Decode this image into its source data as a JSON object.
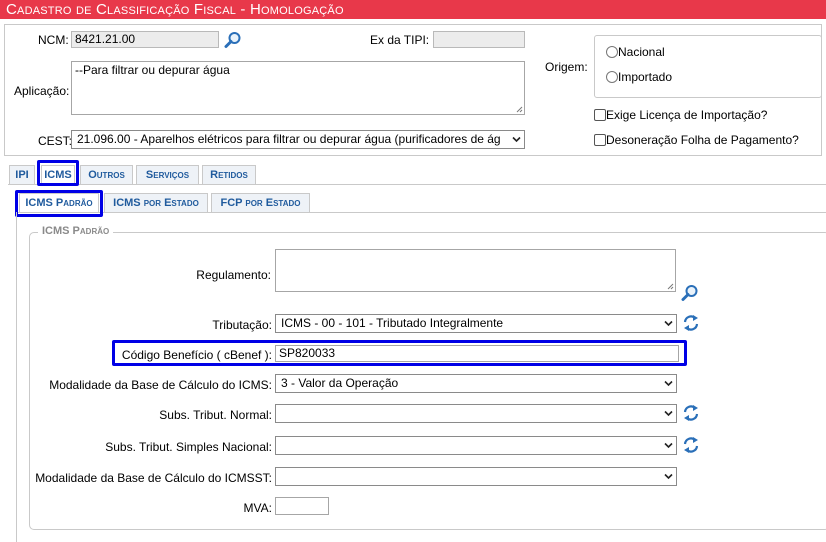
{
  "window": {
    "title": "Cadastro de Classificação Fiscal - Homologação"
  },
  "header": {
    "ncm": {
      "label": "NCM:",
      "value": "8421.21.00"
    },
    "ex_tipi": {
      "label": "Ex da TIPI:",
      "value": ""
    },
    "aplicacao": {
      "label": "Aplicação:",
      "value": "--Para filtrar ou depurar água"
    },
    "cest": {
      "label": "CEST:",
      "value": "21.096.00 - Aparelhos elétricos para filtrar ou depurar água (purificadores de ág"
    },
    "origem": {
      "label": "Origem:",
      "options": [
        "Nacional",
        "Importado"
      ]
    },
    "checks": {
      "licenca": "Exige Licença de Importação?",
      "desoneracao": "Desoneração Folha de Pagamento?"
    }
  },
  "tabs": [
    "IPI",
    "ICMS",
    "Outros",
    "Serviços",
    "Retidos"
  ],
  "subtabs": [
    "ICMS Padrão",
    "ICMS por Estado",
    "FCP por Estado"
  ],
  "icms_padrao": {
    "legend": "ICMS Padrão",
    "regulamento": {
      "label": "Regulamento:",
      "value": ""
    },
    "tributacao": {
      "label": "Tributação:",
      "value": "ICMS - 00 - 101 - Tributado Integralmente"
    },
    "codigo_beneficio": {
      "label": "Código Benefício ( cBenef ):",
      "value": "SP820033"
    },
    "modalidade_bc": {
      "label": "Modalidade da Base de Cálculo do ICMS:",
      "value": "3 - Valor da Operação"
    },
    "subs_normal": {
      "label": "Subs. Tribut. Normal:",
      "value": ""
    },
    "subs_simples": {
      "label": "Subs. Tribut. Simples Nacional:",
      "value": ""
    },
    "modalidade_bcst": {
      "label": "Modalidade da Base de Cálculo do ICMSST:",
      "value": ""
    },
    "mva": {
      "label": "MVA:",
      "value": ""
    }
  },
  "colors": {
    "title_bar": "#e8384a",
    "tab_text": "#1f5a9d",
    "highlight": "#0000e6",
    "icon_blue": "#2a6fb8"
  }
}
